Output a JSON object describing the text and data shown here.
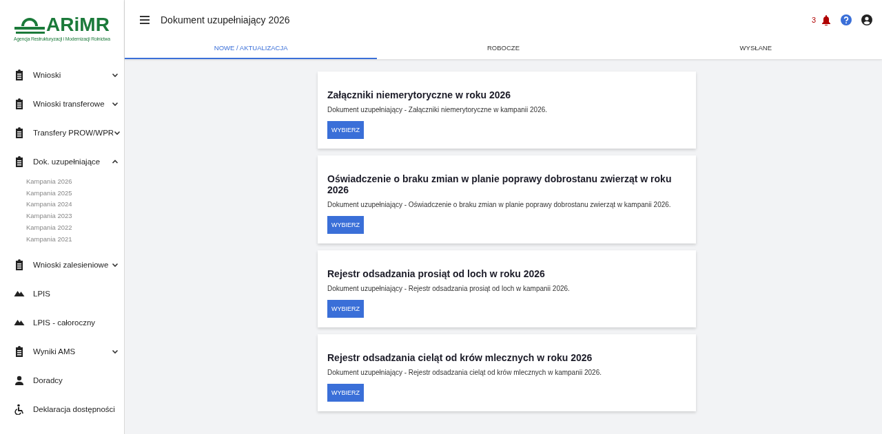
{
  "logo": {
    "name": "ARiMR",
    "subtitle": "Agencja Restrukturyzacji i Modernizacji Rolnictwa"
  },
  "sidebar": {
    "items": [
      {
        "label": "Wnioski",
        "kind": "group",
        "expanded": false
      },
      {
        "label": "Wnioski transferowe",
        "kind": "group",
        "expanded": false
      },
      {
        "label": "Transfery PROW/WPR",
        "kind": "group",
        "expanded": false
      },
      {
        "label": "Dok. uzupełniające",
        "kind": "group",
        "expanded": true,
        "children": [
          {
            "label": "Kampania 2026"
          },
          {
            "label": "Kampania 2025"
          },
          {
            "label": "Kampania 2024"
          },
          {
            "label": "Kampania 2023"
          },
          {
            "label": "Kampania 2022"
          },
          {
            "label": "Kampania 2021"
          }
        ]
      },
      {
        "label": "Wnioski zalesieniowe",
        "kind": "group",
        "expanded": false
      },
      {
        "label": "LPIS",
        "kind": "map"
      },
      {
        "label": "LPIS - całoroczny",
        "kind": "map"
      },
      {
        "label": "Wyniki AMS",
        "kind": "group",
        "expanded": false
      },
      {
        "label": "Doradcy",
        "kind": "person"
      },
      {
        "label": "Deklaracja dostępności",
        "kind": "accessibility"
      }
    ]
  },
  "header": {
    "title": "Dokument uzupełniający 2026",
    "notification_count": "3"
  },
  "tabs": [
    {
      "label": "NOWE / AKTUALIZACJA",
      "selected": true
    },
    {
      "label": "ROBOCZE",
      "selected": false
    },
    {
      "label": "WYSŁANE",
      "selected": false
    }
  ],
  "cards": [
    {
      "title": "Załączniki niemerytoryczne w roku 2026",
      "description": "Dokument uzupełniający - Załączniki niemerytoryczne w kampanii 2026.",
      "button": "WYBIERZ"
    },
    {
      "title": "Oświadczenie o braku zmian w planie poprawy dobrostanu zwierząt w roku 2026",
      "description": "Dokument uzupełniający - Oświadczenie o braku zmian w planie poprawy dobrostanu zwierząt w kampanii 2026.",
      "button": "WYBIERZ"
    },
    {
      "title": "Rejestr odsadzania prosiąt od loch w roku 2026",
      "description": "Dokument uzupełniający - Rejestr odsadzania prosiąt od loch w kampanii 2026.",
      "button": "WYBIERZ"
    },
    {
      "title": "Rejestr odsadzania cieląt od krów mlecznych w roku 2026",
      "description": "Dokument uzupełniający - Rejestr odsadzania cieląt od krów mlecznych w kampanii 2026.",
      "button": "WYBIERZ"
    }
  ]
}
